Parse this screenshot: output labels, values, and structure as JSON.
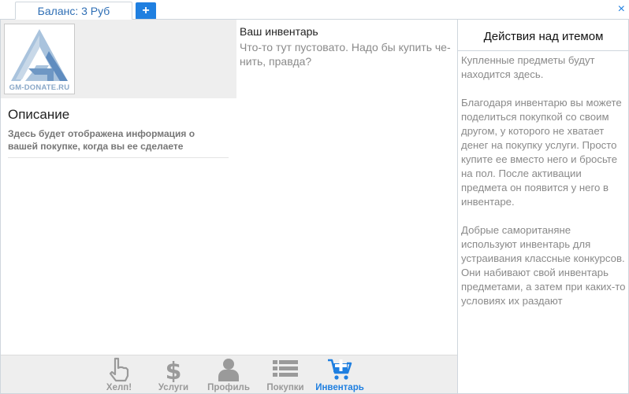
{
  "topbar": {
    "balance_tab": "Баланс: 3 Руб",
    "add_button": "+",
    "close_button": "×"
  },
  "product": {
    "logo_text": "GM-DONATE.RU"
  },
  "description": {
    "title": "Описание",
    "text": "Здесь будет отображена информация о вашей покупке, когда вы ее сделаете"
  },
  "inventory": {
    "title": "Ваш инвентарь",
    "empty_text": "Что-то тут пустовато. Надо бы купить че-нить, правда?"
  },
  "sidebar": {
    "title": "Действия над итемом",
    "paragraphs": [
      "Купленные предметы будут находится здесь.",
      "Благодаря инвентарю вы можете поделиться покупкой со своим другом, у которого не хватает денег на покупку услуги. Просто купите ее вместо него и бросьте на пол. После активации предмета он появится у него в инвентаре.",
      "Добрые самоританяне используют инвентарь для устраивания классные конкурсов. Они набивают свой инвентарь предметами, а затем при каких-то условиях их раздают"
    ]
  },
  "bottom_nav": {
    "items": [
      {
        "label": "Хелп!",
        "icon": "hand-pointer-icon"
      },
      {
        "label": "Услуги",
        "icon": "dollar-icon"
      },
      {
        "label": "Профиль",
        "icon": "user-icon"
      },
      {
        "label": "Покупки",
        "icon": "list-icon"
      },
      {
        "label": "Инвентарь",
        "icon": "cart-plus-icon",
        "active": true
      }
    ]
  },
  "colors": {
    "accent": "#1f7fe0",
    "inactive_icon": "#9a9a9a",
    "panel_bg": "#eeeeee"
  }
}
